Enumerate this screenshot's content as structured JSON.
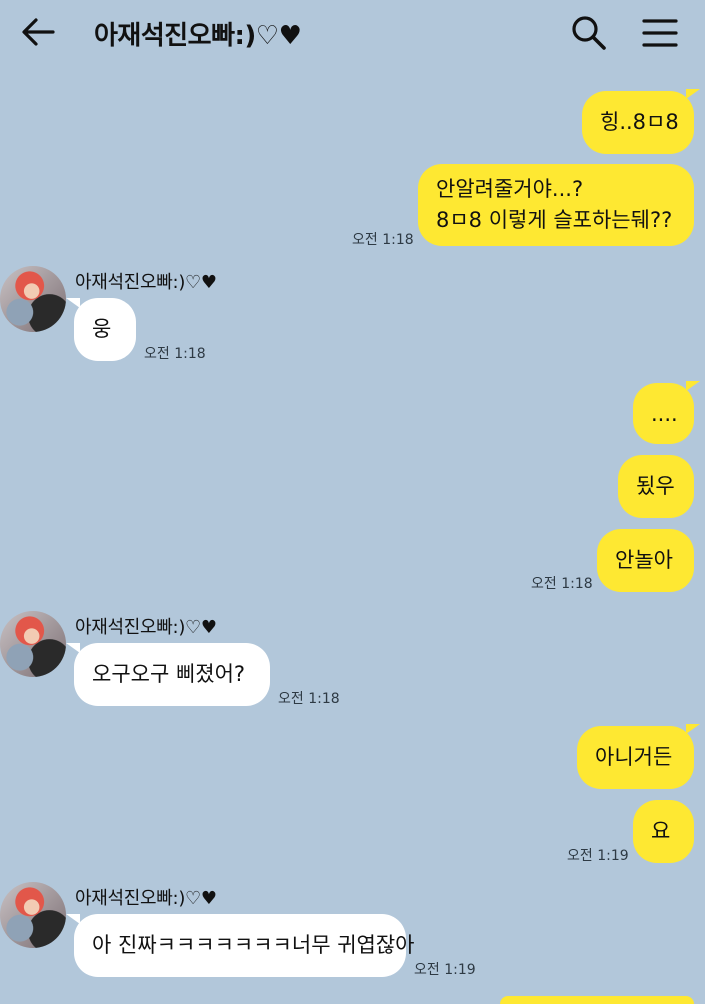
{
  "header": {
    "title": "아재석진오빠:)♡♥"
  },
  "messages": [
    {
      "from": "me",
      "text": "힝..8ㅁ8"
    },
    {
      "from": "me",
      "lines": [
        "안알려줄거야...?",
        "8ㅁ8 이렇게 슬포하는뒈??"
      ],
      "time": "오전 1:18"
    },
    {
      "from": "other",
      "sender": "아재석진오빠:)♡♥",
      "text": "웅",
      "time": "오전 1:18"
    },
    {
      "from": "me",
      "text": "...."
    },
    {
      "from": "me",
      "text": "됬우"
    },
    {
      "from": "me",
      "text": "안놀아",
      "time": "오전 1:18"
    },
    {
      "from": "other",
      "sender": "아재석진오빠:)♡♥",
      "text": "오구오구 삐졌어?",
      "time": "오전 1:18"
    },
    {
      "from": "me",
      "text": "아니거든"
    },
    {
      "from": "me",
      "text": "요",
      "time": "오전 1:19"
    },
    {
      "from": "other",
      "sender": "아재석진오빠:)♡♥",
      "text": "아 진짜ㅋㅋㅋㅋㅋㅋㅋ너무 귀엽잖아",
      "time": "오전 1:19"
    }
  ]
}
